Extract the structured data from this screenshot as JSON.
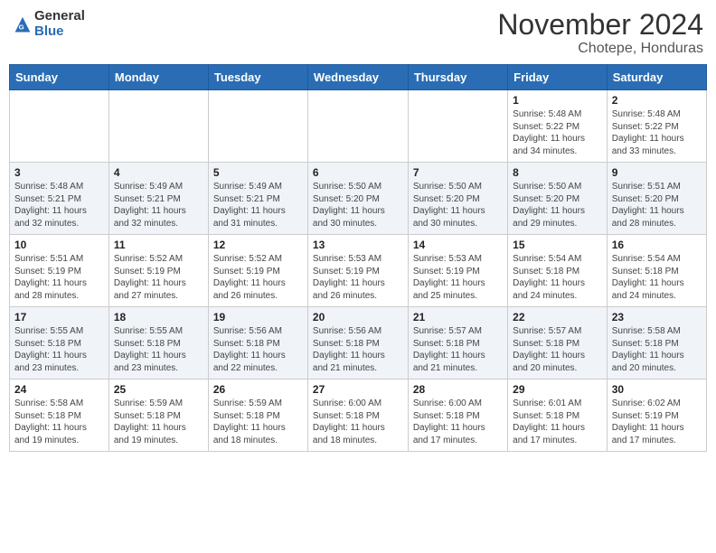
{
  "header": {
    "logo_general": "General",
    "logo_blue": "Blue",
    "month": "November 2024",
    "location": "Chotepe, Honduras"
  },
  "weekdays": [
    "Sunday",
    "Monday",
    "Tuesday",
    "Wednesday",
    "Thursday",
    "Friday",
    "Saturday"
  ],
  "weeks": [
    [
      {
        "day": "",
        "info": ""
      },
      {
        "day": "",
        "info": ""
      },
      {
        "day": "",
        "info": ""
      },
      {
        "day": "",
        "info": ""
      },
      {
        "day": "",
        "info": ""
      },
      {
        "day": "1",
        "info": "Sunrise: 5:48 AM\nSunset: 5:22 PM\nDaylight: 11 hours\nand 34 minutes."
      },
      {
        "day": "2",
        "info": "Sunrise: 5:48 AM\nSunset: 5:22 PM\nDaylight: 11 hours\nand 33 minutes."
      }
    ],
    [
      {
        "day": "3",
        "info": "Sunrise: 5:48 AM\nSunset: 5:21 PM\nDaylight: 11 hours\nand 32 minutes."
      },
      {
        "day": "4",
        "info": "Sunrise: 5:49 AM\nSunset: 5:21 PM\nDaylight: 11 hours\nand 32 minutes."
      },
      {
        "day": "5",
        "info": "Sunrise: 5:49 AM\nSunset: 5:21 PM\nDaylight: 11 hours\nand 31 minutes."
      },
      {
        "day": "6",
        "info": "Sunrise: 5:50 AM\nSunset: 5:20 PM\nDaylight: 11 hours\nand 30 minutes."
      },
      {
        "day": "7",
        "info": "Sunrise: 5:50 AM\nSunset: 5:20 PM\nDaylight: 11 hours\nand 30 minutes."
      },
      {
        "day": "8",
        "info": "Sunrise: 5:50 AM\nSunset: 5:20 PM\nDaylight: 11 hours\nand 29 minutes."
      },
      {
        "day": "9",
        "info": "Sunrise: 5:51 AM\nSunset: 5:20 PM\nDaylight: 11 hours\nand 28 minutes."
      }
    ],
    [
      {
        "day": "10",
        "info": "Sunrise: 5:51 AM\nSunset: 5:19 PM\nDaylight: 11 hours\nand 28 minutes."
      },
      {
        "day": "11",
        "info": "Sunrise: 5:52 AM\nSunset: 5:19 PM\nDaylight: 11 hours\nand 27 minutes."
      },
      {
        "day": "12",
        "info": "Sunrise: 5:52 AM\nSunset: 5:19 PM\nDaylight: 11 hours\nand 26 minutes."
      },
      {
        "day": "13",
        "info": "Sunrise: 5:53 AM\nSunset: 5:19 PM\nDaylight: 11 hours\nand 26 minutes."
      },
      {
        "day": "14",
        "info": "Sunrise: 5:53 AM\nSunset: 5:19 PM\nDaylight: 11 hours\nand 25 minutes."
      },
      {
        "day": "15",
        "info": "Sunrise: 5:54 AM\nSunset: 5:18 PM\nDaylight: 11 hours\nand 24 minutes."
      },
      {
        "day": "16",
        "info": "Sunrise: 5:54 AM\nSunset: 5:18 PM\nDaylight: 11 hours\nand 24 minutes."
      }
    ],
    [
      {
        "day": "17",
        "info": "Sunrise: 5:55 AM\nSunset: 5:18 PM\nDaylight: 11 hours\nand 23 minutes."
      },
      {
        "day": "18",
        "info": "Sunrise: 5:55 AM\nSunset: 5:18 PM\nDaylight: 11 hours\nand 23 minutes."
      },
      {
        "day": "19",
        "info": "Sunrise: 5:56 AM\nSunset: 5:18 PM\nDaylight: 11 hours\nand 22 minutes."
      },
      {
        "day": "20",
        "info": "Sunrise: 5:56 AM\nSunset: 5:18 PM\nDaylight: 11 hours\nand 21 minutes."
      },
      {
        "day": "21",
        "info": "Sunrise: 5:57 AM\nSunset: 5:18 PM\nDaylight: 11 hours\nand 21 minutes."
      },
      {
        "day": "22",
        "info": "Sunrise: 5:57 AM\nSunset: 5:18 PM\nDaylight: 11 hours\nand 20 minutes."
      },
      {
        "day": "23",
        "info": "Sunrise: 5:58 AM\nSunset: 5:18 PM\nDaylight: 11 hours\nand 20 minutes."
      }
    ],
    [
      {
        "day": "24",
        "info": "Sunrise: 5:58 AM\nSunset: 5:18 PM\nDaylight: 11 hours\nand 19 minutes."
      },
      {
        "day": "25",
        "info": "Sunrise: 5:59 AM\nSunset: 5:18 PM\nDaylight: 11 hours\nand 19 minutes."
      },
      {
        "day": "26",
        "info": "Sunrise: 5:59 AM\nSunset: 5:18 PM\nDaylight: 11 hours\nand 18 minutes."
      },
      {
        "day": "27",
        "info": "Sunrise: 6:00 AM\nSunset: 5:18 PM\nDaylight: 11 hours\nand 18 minutes."
      },
      {
        "day": "28",
        "info": "Sunrise: 6:00 AM\nSunset: 5:18 PM\nDaylight: 11 hours\nand 17 minutes."
      },
      {
        "day": "29",
        "info": "Sunrise: 6:01 AM\nSunset: 5:18 PM\nDaylight: 11 hours\nand 17 minutes."
      },
      {
        "day": "30",
        "info": "Sunrise: 6:02 AM\nSunset: 5:19 PM\nDaylight: 11 hours\nand 17 minutes."
      }
    ]
  ]
}
